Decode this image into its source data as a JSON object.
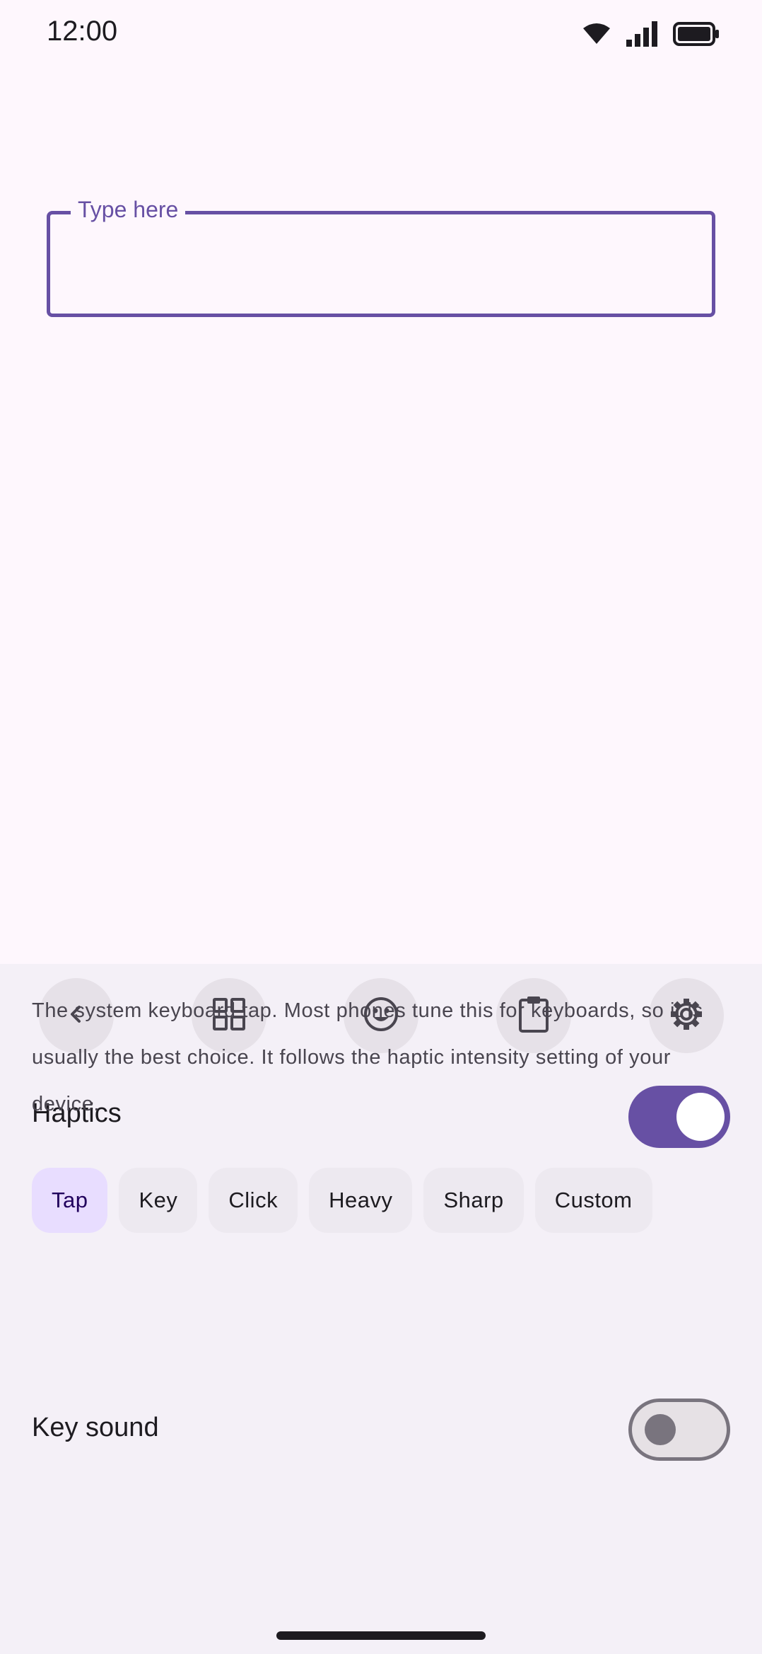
{
  "status_bar": {
    "time": "12:00",
    "icons": [
      "wifi-icon",
      "signal-icon",
      "battery-icon"
    ]
  },
  "text_field": {
    "label": "Type here",
    "value": ""
  },
  "toolbar": {
    "buttons": [
      "back-icon",
      "grid-icon",
      "emoji-icon",
      "clipboard-icon",
      "settings-icon"
    ]
  },
  "haptics": {
    "label": "Haptics",
    "enabled": true,
    "options": [
      "Tap",
      "Key",
      "Click",
      "Heavy",
      "Sharp",
      "Custom"
    ],
    "selected": "Tap",
    "description": "The system keyboard tap. Most phones tune this for keyboards, so it is usually the best choice. It follows the haptic intensity setting of your device."
  },
  "key_sound": {
    "label": "Key sound",
    "enabled": false
  },
  "colors": {
    "accent": "#6750a4",
    "background": "#fef7fd",
    "panel": "#f4f0f7",
    "chip_selected": "#e8ddff"
  }
}
